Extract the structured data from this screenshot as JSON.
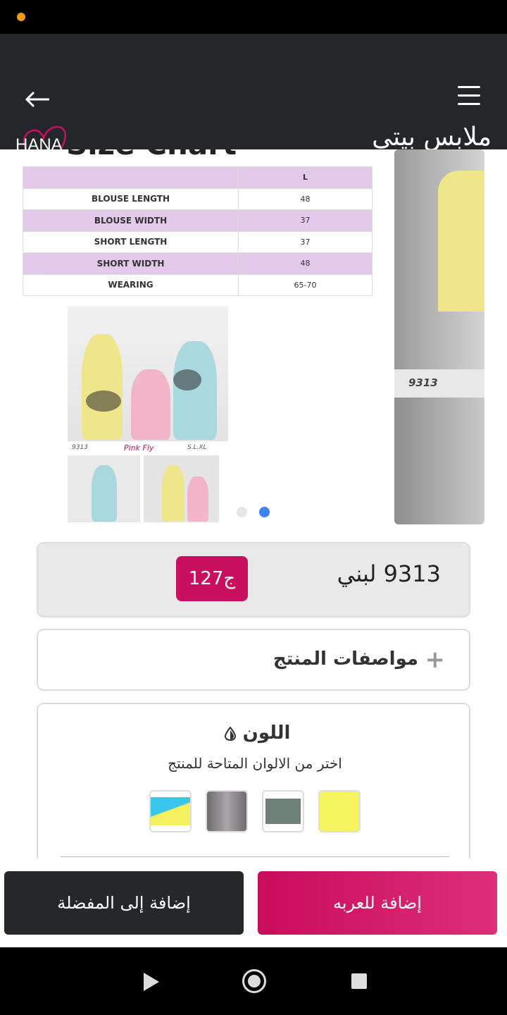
{
  "app": {
    "title": "ملابس بيتي",
    "logo_text": "HANA",
    "brand_color": "#c8105e",
    "appbar_color": "#25262a"
  },
  "icons": {
    "back": "arrow-left-icon",
    "menu": "hamburger-menu-icon",
    "expand": "plus-icon",
    "color": "drop-icon"
  },
  "carousel": {
    "size_chart_title": "Size Chart",
    "size_column": "L",
    "rows": [
      {
        "label": "BLOUSE LENGTH",
        "value": "48"
      },
      {
        "label": "BLOUSE WIDTH",
        "value": "37"
      },
      {
        "label": "SHORT LENGTH",
        "value": "37"
      },
      {
        "label": "SHORT WIDTH",
        "value": "48"
      },
      {
        "label": "WEARING",
        "value": "65-70"
      }
    ],
    "photo_caption_code": "9313",
    "photo_caption_brand": "Pink Fly",
    "photo_caption_sizes": "S.L.XL",
    "next_slide_caption": "9313",
    "slide_count": 2,
    "active_slide": 2
  },
  "product": {
    "name": "9313 لبني",
    "price": "127ج"
  },
  "specs": {
    "label": "مواصفات المنتج"
  },
  "color": {
    "title": "اللون",
    "subtitle": "اختر من الالوان المتاحة للمنتج",
    "swatches": [
      {
        "name": "yellow",
        "color": "#f7f55f"
      },
      {
        "name": "grey-green",
        "color": "#6e8077"
      },
      {
        "name": "grey",
        "color": "#8b878a"
      },
      {
        "name": "light-blue-yellow",
        "color": "#39c6ea"
      }
    ]
  },
  "actions": {
    "add_to_favorites": "إضافة إلى المفضلة",
    "add_to_cart": "إضافة للعربه"
  }
}
